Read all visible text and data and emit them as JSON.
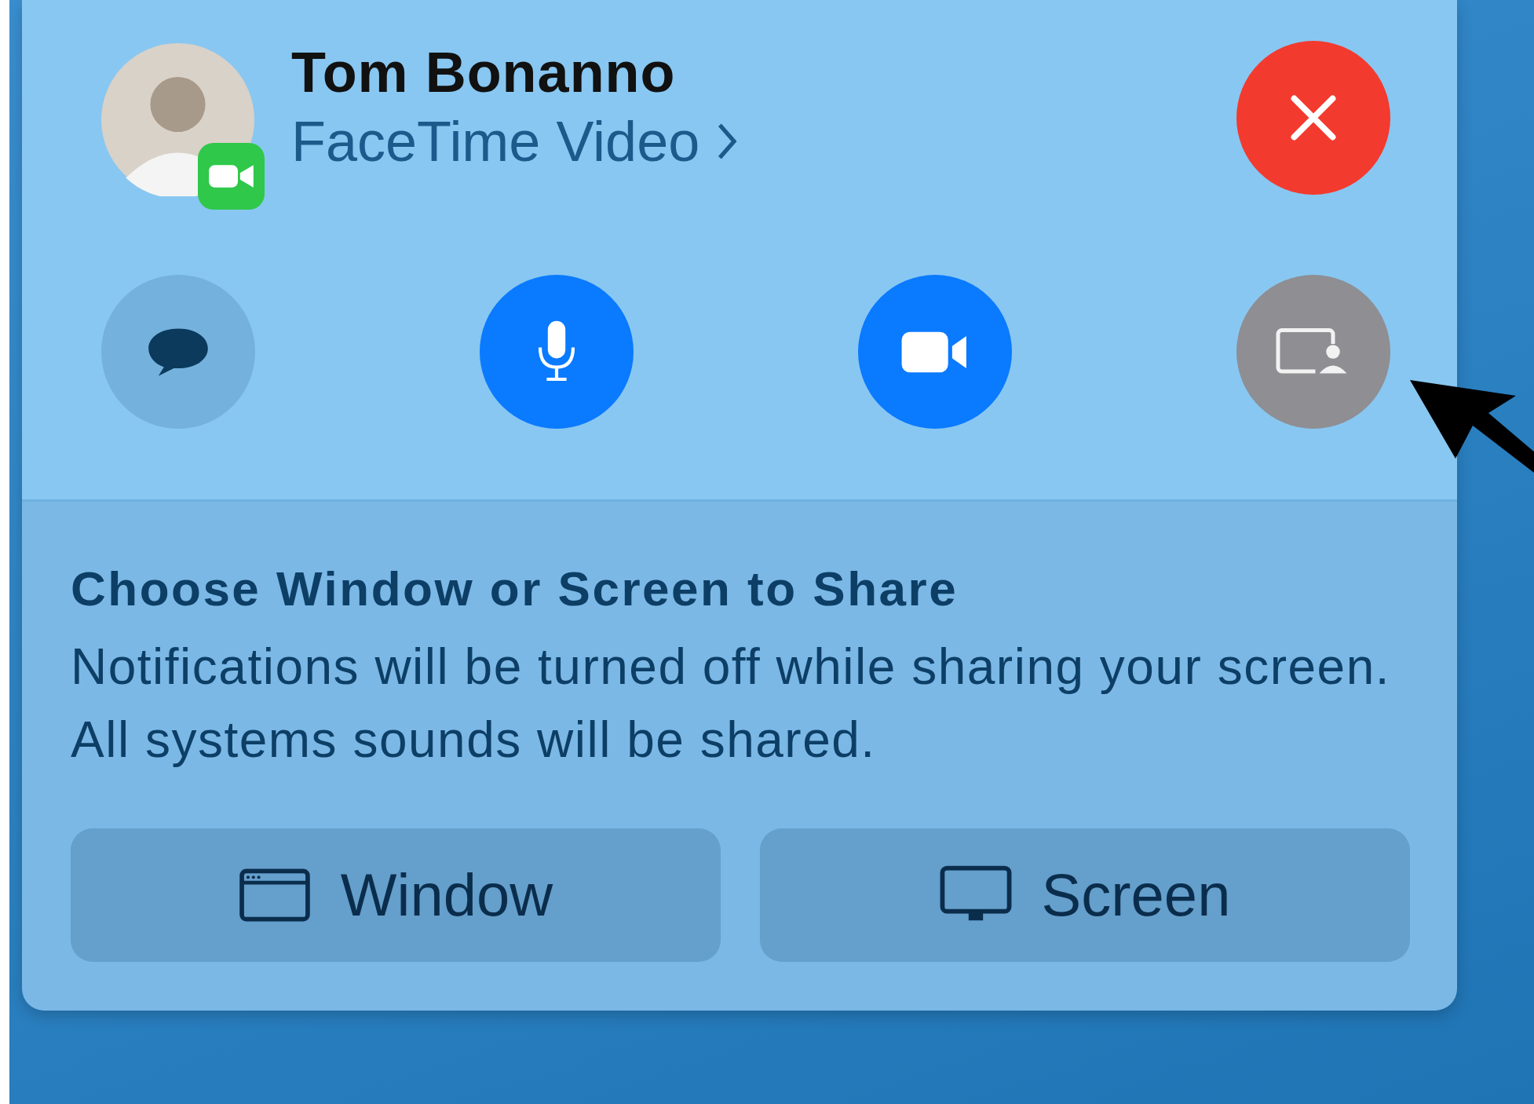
{
  "contact": {
    "name": "Tom Bonanno",
    "call_type": "FaceTime Video"
  },
  "controls": [
    {
      "kind": "message",
      "on": false
    },
    {
      "kind": "microphone",
      "on": true
    },
    {
      "kind": "camera",
      "on": true
    },
    {
      "kind": "share",
      "on": false
    }
  ],
  "share_panel": {
    "title": "Choose Window or Screen to Share",
    "message": "Notifications will be turned off while sharing your screen. All systems sounds will be shared.",
    "buttons": [
      {
        "kind": "window",
        "label": "Window"
      },
      {
        "kind": "screen",
        "label": "Screen"
      }
    ]
  }
}
